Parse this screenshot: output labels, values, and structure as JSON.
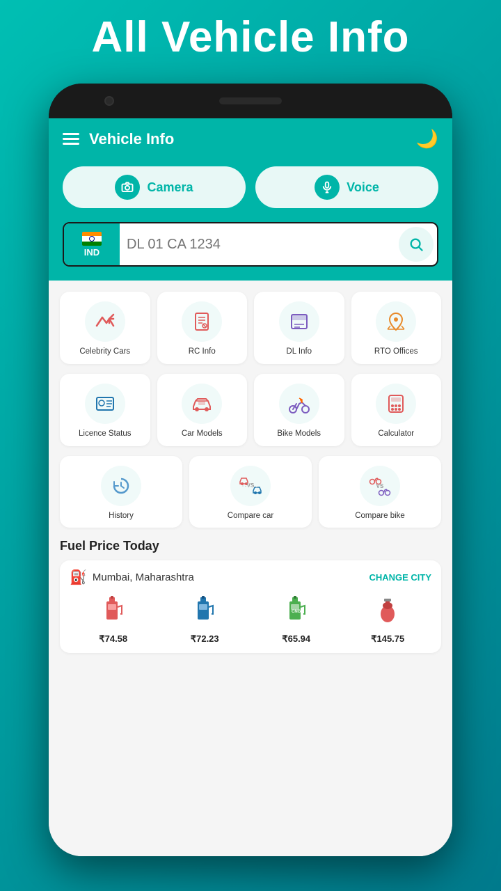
{
  "background": {
    "title": "All Vehicle Info",
    "gradient_start": "#00bfb3",
    "gradient_end": "#007a8c"
  },
  "header": {
    "title": "Vehicle Info",
    "dark_mode_icon": "🌙"
  },
  "buttons": {
    "camera_label": "Camera",
    "voice_label": "Voice"
  },
  "search": {
    "placeholder": "DL 01 CA 1234",
    "country_code": "IND"
  },
  "menu_row1": [
    {
      "id": "celebrity-cars",
      "label": "Celebrity Cars",
      "icon_type": "trending"
    },
    {
      "id": "rc-info",
      "label": "RC Info",
      "icon_type": "rc"
    },
    {
      "id": "dl-info",
      "label": "DL Info",
      "icon_type": "dl"
    },
    {
      "id": "rto-offices",
      "label": "RTO Offices",
      "icon_type": "rto"
    }
  ],
  "menu_row2": [
    {
      "id": "licence-status",
      "label": "Licence Status",
      "icon_type": "licence"
    },
    {
      "id": "car-models",
      "label": "Car Models",
      "icon_type": "car"
    },
    {
      "id": "bike-models",
      "label": "Bike Models",
      "icon_type": "bike"
    },
    {
      "id": "calculator",
      "label": "Calculator",
      "icon_type": "calculator"
    }
  ],
  "menu_row3": [
    {
      "id": "history",
      "label": "History",
      "icon_type": "history"
    },
    {
      "id": "compare-car",
      "label": "Compare car",
      "icon_type": "compare-car"
    },
    {
      "id": "compare-bike",
      "label": "Compare bike",
      "icon_type": "compare-bike"
    }
  ],
  "fuel_section": {
    "title": "Fuel Price Today",
    "city": "Mumbai, Maharashtra",
    "change_city_label": "CHANGE CITY",
    "prices": [
      {
        "id": "petrol",
        "icon": "⛽",
        "icon_color": "#e05a5a",
        "price": "₹74.58"
      },
      {
        "id": "diesel",
        "icon": "🔵",
        "icon_color": "#2176ae",
        "price": "₹72.23"
      },
      {
        "id": "cng",
        "icon": "🟢",
        "icon_color": "#3cb043",
        "price": "₹65.94"
      },
      {
        "id": "lpg",
        "icon": "🔴",
        "icon_color": "#e05a5a",
        "price": "₹145.75"
      }
    ]
  }
}
